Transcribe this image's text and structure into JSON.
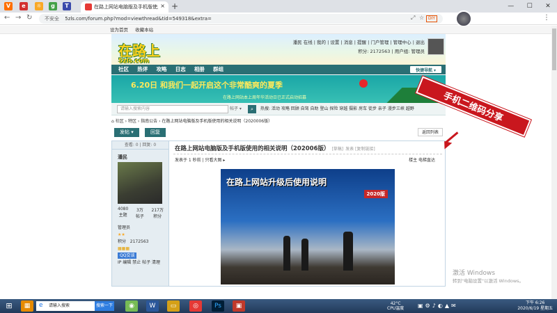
{
  "browser": {
    "tab_title": "在路上网站电脑版及手机版使用…",
    "omnibox_security": "不安全",
    "url": "5zls.com/forum.php?mod=viewthread&tid=549318&extra=",
    "diy": "DIY"
  },
  "site": {
    "topnav": [
      "设为首页",
      "收藏本站"
    ],
    "logo": "在路上",
    "logo_sub": "5zls.com",
    "user_line1": [
      "潘民",
      "在线",
      "我的",
      "设置",
      "消息",
      "提醒",
      "门户管理",
      "管理中心",
      "退出"
    ],
    "user_line2": "积分: 2172563",
    "user_group": "用户组: 管理员",
    "mainnav": [
      "社区",
      "热评",
      "攻略",
      "日志",
      "相册",
      "群组"
    ],
    "quicknav": "快捷导航",
    "banner_title": "6.20日 和我们一起开启这个非常酷爽的夏季",
    "banner_sub": "在路上网站本上周年华活动日已正式启动招募",
    "search_placeholder": "请输入搜索内容",
    "search_scope": "帖子",
    "hot": "热搜: 活动 攻略 回顾 自驾 自助 登山 探险 穿越 摄影 房车 徒步 亲子 漫步三峡 越野",
    "breadcrumb": "社区 › 特区 › 指南公告 › 在路上网站电脑版及手机版使用的相关说明（2020006版）",
    "btn_post": "发帖",
    "btn_reply": "回复",
    "btn_back": "返回列表"
  },
  "post": {
    "stat": "查看: 0 | 回复: 0",
    "author": "潘民",
    "nums": [
      {
        "v": "4080",
        "l": "主题"
      },
      {
        "v": "3万",
        "l": "帖子"
      },
      {
        "v": "217万",
        "l": "积分"
      }
    ],
    "role": "管理员",
    "points_label": "积分",
    "points": "2172563",
    "qq": "QQ交谈",
    "admin_links": "IP 编辑 禁止 帖子 清理",
    "title": "在路上网站电脑版及手机版使用的相关说明（202006版）",
    "title_tag": "[草稿]",
    "title_links": "发表  [复制链接]",
    "meta": "发表于 1 秒前  |  只看大图 ▸",
    "floor": "楼主  电梯直达",
    "image_title": "在路上网站升级后使用说明",
    "image_badge": "2020版"
  },
  "annotation": "手机二维码分享",
  "watermark": {
    "line1": "激活 Windows",
    "line2": "转到\"电脑设置\"以激活 Windows。"
  },
  "taskbar": {
    "search": "请输入搜索",
    "search_btn": "搜索一下",
    "temp": "42°C",
    "temp_label": "CPU温度",
    "time": "下午 6:26",
    "date": "2020/6/19 星期五"
  }
}
